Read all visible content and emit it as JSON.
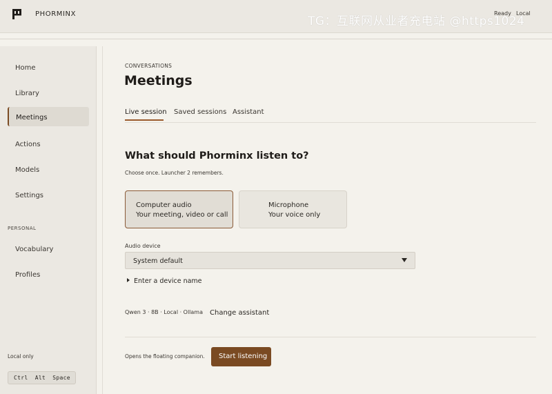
{
  "app": {
    "name": "PHORMINX",
    "status": "Ready",
    "status_secondary": "Local",
    "watermark": "TG：互联网从业者充电站 @https1024"
  },
  "sidebar": {
    "items": [
      {
        "label": "Home"
      },
      {
        "label": "Library"
      },
      {
        "label": "Meetings",
        "active": true
      },
      {
        "label": "Actions"
      },
      {
        "label": "Models"
      },
      {
        "label": "Settings"
      }
    ],
    "section_label": "PERSONAL",
    "personal_items": [
      {
        "label": "Vocabulary"
      },
      {
        "label": "Profiles"
      }
    ],
    "footer_label": "Local only",
    "shortcut": "Ctrl  Alt  Space"
  },
  "main": {
    "eyebrow": "CONVERSATIONS",
    "title": "Meetings",
    "tabs": [
      {
        "label": "Live session",
        "active": true
      },
      {
        "label": "Saved sessions"
      },
      {
        "label": "Assistant"
      }
    ],
    "question": "What should Phorminx listen to?",
    "hint": "Choose once. Launcher 2 remembers.",
    "options": [
      {
        "title": "Computer audio",
        "subtitle": "Your meeting, video or call",
        "selected": true
      },
      {
        "title": "Microphone",
        "subtitle": "Your voice only",
        "selected": false
      }
    ],
    "audio_device": {
      "label": "Audio device",
      "value": "System default"
    },
    "manual_device_label": "Enter a device name",
    "model_info": "Qwen 3 · 8B · Local · Ollama",
    "change_assistant_label": "Change assistant",
    "footer_note": "Opens the floating companion.",
    "start_button_label": "Start listening"
  },
  "colors": {
    "accent": "#7a4a22",
    "background": "#f4f2ec",
    "sidebar": "#ebe8e2"
  }
}
